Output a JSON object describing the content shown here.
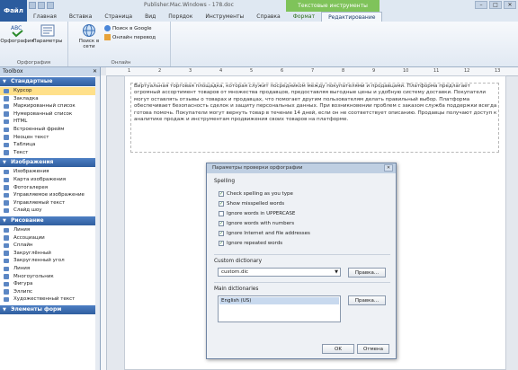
{
  "window": {
    "app_menu": "Файл",
    "title": "Publisher.Mac.Windows - 178.doc",
    "context_header": "Текстовые инструменты",
    "controls": [
      "–",
      "□",
      "✕"
    ]
  },
  "tabs": [
    {
      "label": "Главная",
      "active": false,
      "context": false
    },
    {
      "label": "Вставка",
      "active": false,
      "context": false
    },
    {
      "label": "Страница",
      "active": false,
      "context": false
    },
    {
      "label": "Вид",
      "active": false,
      "context": false
    },
    {
      "label": "Порядок",
      "active": false,
      "context": false
    },
    {
      "label": "Инструменты",
      "active": false,
      "context": false
    },
    {
      "label": "Справка",
      "active": false,
      "context": false
    },
    {
      "label": "Формат",
      "active": false,
      "context": true
    },
    {
      "label": "Редактирование",
      "active": true,
      "context": true
    }
  ],
  "ribbon": {
    "group_proofing": {
      "spelling_label": "Орфография",
      "params_label": "Параметры",
      "group_label": "Орфография"
    },
    "group_online": {
      "check_online_label": "Поиск в сети",
      "search_google": "Поиск в Google",
      "translate": "Онлайн перевод",
      "group_label": "Онлайн"
    }
  },
  "toolbox": {
    "title": "Toolbox",
    "close_glyph": "✕",
    "sections": [
      {
        "label": "Стандартные",
        "items": [
          "Курсор",
          "Закладка",
          "Маркированный список",
          "Нумерованный список",
          "HTML",
          "Встроенный фрейм",
          "Неоцен текст",
          "Таблица",
          "Текст"
        ]
      },
      {
        "label": "Изображения",
        "items": [
          "Изображения",
          "Карта изображения",
          "Фотогалерея",
          "Управляемое изображение",
          "Управляемый текст",
          "Слайд шоу"
        ]
      },
      {
        "label": "Рисование",
        "items": [
          "Линия",
          "Ассоциации",
          "Сплайн",
          "Закруглённый",
          "Закругленный угол",
          "Линия",
          "Многоугольник",
          "Фигура",
          "Эллипс",
          "Художественный текст"
        ]
      },
      {
        "label": "Элементы форм",
        "items": []
      }
    ],
    "selected_item": "Курсор"
  },
  "document": {
    "ruler_numbers": [
      "1",
      "2",
      "3",
      "4",
      "5",
      "6",
      "7",
      "8",
      "9",
      "10",
      "11",
      "12",
      "13"
    ],
    "body_text": "Виртуальная торговая площадка, которая служит посредником между покупателями и продавцами. Платформа предлагает огромный ассортимент товаров от множества продавцов, предоставляя выгодные цены и удобную систему доставки. Покупатели могут оставлять отзывы о товарах и продавцах, что помогает другим пользователям делать правильный выбор. Платформа обеспечивает безопасность сделок и защиту персональных данных. При возникновении проблем с заказом служба поддержки всегда готова помочь. Покупатели могут вернуть товар в течение 14 дней, если он не соответствует описанию. Продавцы получают доступ к аналитике продаж и инструментам продвижения своих товаров на платформе."
  },
  "dialog": {
    "title": "Параметры проверки орфографии",
    "close_glyph": "✕",
    "spelling_label": "Spelling",
    "options": [
      {
        "label": "Check spelling as you type",
        "checked": true
      },
      {
        "label": "Show misspelled words",
        "checked": true
      },
      {
        "label": "Ignore words in UPPERCASE",
        "checked": false
      },
      {
        "label": "Ignore words with numbers",
        "checked": true
      },
      {
        "label": "Ignore Internet and file addresses",
        "checked": true
      },
      {
        "label": "Ignore repeated words",
        "checked": true
      }
    ],
    "custom_dict_label": "Custom dictionary",
    "custom_dict_value": "custom.dic",
    "edit_button": "Правка...",
    "main_dict_label": "Main dictionaries",
    "main_dict_item": "English (US)",
    "modify_button": "Правка...",
    "ok": "OK",
    "cancel": "Отмена"
  }
}
